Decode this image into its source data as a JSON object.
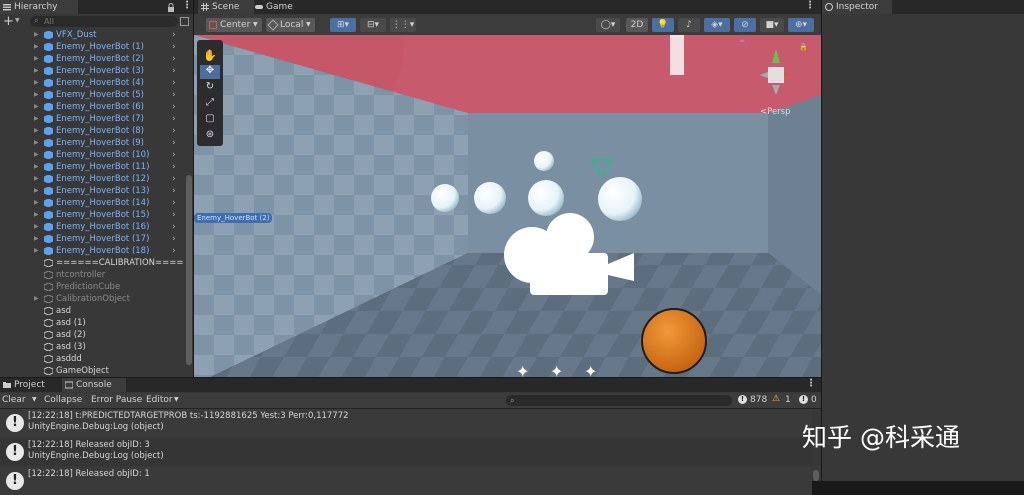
{
  "hierarchy": {
    "tab_label": "Hierarchy",
    "search_placeholder": "All",
    "add_label": "+",
    "items": [
      {
        "label": "VFX_Dust",
        "kind": "prefab"
      },
      {
        "label": "Enemy_HoverBot (1)",
        "kind": "prefab"
      },
      {
        "label": "Enemy_HoverBot (2)",
        "kind": "prefab"
      },
      {
        "label": "Enemy_HoverBot (3)",
        "kind": "prefab"
      },
      {
        "label": "Enemy_HoverBot (4)",
        "kind": "prefab"
      },
      {
        "label": "Enemy_HoverBot (5)",
        "kind": "prefab"
      },
      {
        "label": "Enemy_HoverBot (6)",
        "kind": "prefab"
      },
      {
        "label": "Enemy_HoverBot (7)",
        "kind": "prefab"
      },
      {
        "label": "Enemy_HoverBot (8)",
        "kind": "prefab"
      },
      {
        "label": "Enemy_HoverBot (9)",
        "kind": "prefab"
      },
      {
        "label": "Enemy_HoverBot (10)",
        "kind": "prefab"
      },
      {
        "label": "Enemy_HoverBot (11)",
        "kind": "prefab"
      },
      {
        "label": "Enemy_HoverBot (12)",
        "kind": "prefab"
      },
      {
        "label": "Enemy_HoverBot (13)",
        "kind": "prefab"
      },
      {
        "label": "Enemy_HoverBot (14)",
        "kind": "prefab"
      },
      {
        "label": "Enemy_HoverBot (15)",
        "kind": "prefab"
      },
      {
        "label": "Enemy_HoverBot (16)",
        "kind": "prefab"
      },
      {
        "label": "Enemy_HoverBot (17)",
        "kind": "prefab"
      },
      {
        "label": "Enemy_HoverBot (18)",
        "kind": "prefab"
      },
      {
        "label": "======CALIBRATION=====",
        "kind": "norm"
      },
      {
        "label": "ntcontroller",
        "kind": "dim"
      },
      {
        "label": "PredictionCube",
        "kind": "dim"
      },
      {
        "label": "CalibrationObject",
        "kind": "dim"
      },
      {
        "label": "asd",
        "kind": "norm"
      },
      {
        "label": "asd (1)",
        "kind": "norm"
      },
      {
        "label": "asd (2)",
        "kind": "norm"
      },
      {
        "label": "asd (3)",
        "kind": "norm"
      },
      {
        "label": "asddd",
        "kind": "norm"
      },
      {
        "label": "GameObject",
        "kind": "norm"
      }
    ]
  },
  "scene": {
    "tabs": [
      "Scene",
      "Game"
    ],
    "pivot_label": "Center",
    "space_label": "Local",
    "mode_2d_label": "2D",
    "persp_label": "Persp",
    "floating_label": "Enemy_HoverBot (2)"
  },
  "console": {
    "tabs": [
      "Project",
      "Console"
    ],
    "clear_label": "Clear",
    "collapse_label": "Collapse",
    "error_pause_label": "Error Pause",
    "editor_label": "Editor",
    "count_info": "878",
    "count_warn": "1",
    "count_error": "0",
    "logs": [
      {
        "line1": "[12:22:18] t:PREDICTEDTARGETPROB ts:-1192881625 Yest:3 Perr:0,117772",
        "line2": "UnityEngine.Debug:Log (object)"
      },
      {
        "line1": "[12:22:18] Released objID: 3",
        "line2": "UnityEngine.Debug:Log (object)"
      },
      {
        "line1": "[12:22:18] Released objID: 1",
        "line2": ""
      }
    ]
  },
  "inspector": {
    "tab_label": "Inspector"
  },
  "watermark": "知乎 @科采通",
  "colors": {
    "accent": "#4a6fa0",
    "prefab_text": "#7ab4ff",
    "sky": "#c85a6e",
    "orange_ball": "#e07a1a"
  }
}
